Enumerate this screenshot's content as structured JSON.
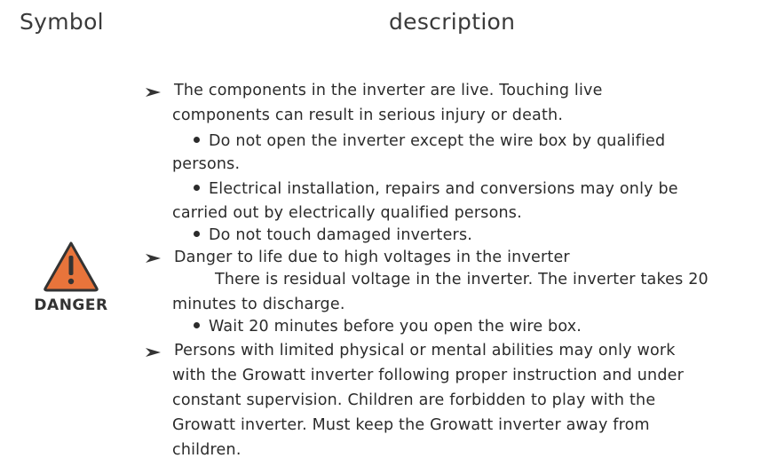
{
  "header": {
    "symbol": "Symbol",
    "description": "description"
  },
  "danger": {
    "label": "DANGER",
    "icon": "warning-triangle-icon",
    "color": "#e8743b"
  },
  "items": {
    "i1_l1": "The components in the inverter are live. Touching live",
    "i1_l2": "components can result in serious injury or death.",
    "b1_l1": "Do not open the inverter except the wire box by qualified",
    "b1_l2": "persons.",
    "b2_l1": "Electrical installation, repairs and conversions may only be",
    "b2_l2": "carried out by electrically qualified persons.",
    "b3": "Do not touch damaged inverters.",
    "i2_l1": "Danger to life due to high voltages in the inverter",
    "i2_l2": "There is residual voltage in the inverter. The inverter takes 20",
    "i2_l3": "minutes to discharge.",
    "b4": "Wait 20 minutes before you open the wire box.",
    "i3_l1": "Persons with limited physical or mental abilities may only work",
    "i3_l2": "with the Growatt inverter following proper instruction and under",
    "i3_l3": "constant supervision. Children are forbidden to play with the",
    "i3_l4": "Growatt inverter. Must keep the Growatt inverter away from",
    "i3_l5": "children."
  }
}
